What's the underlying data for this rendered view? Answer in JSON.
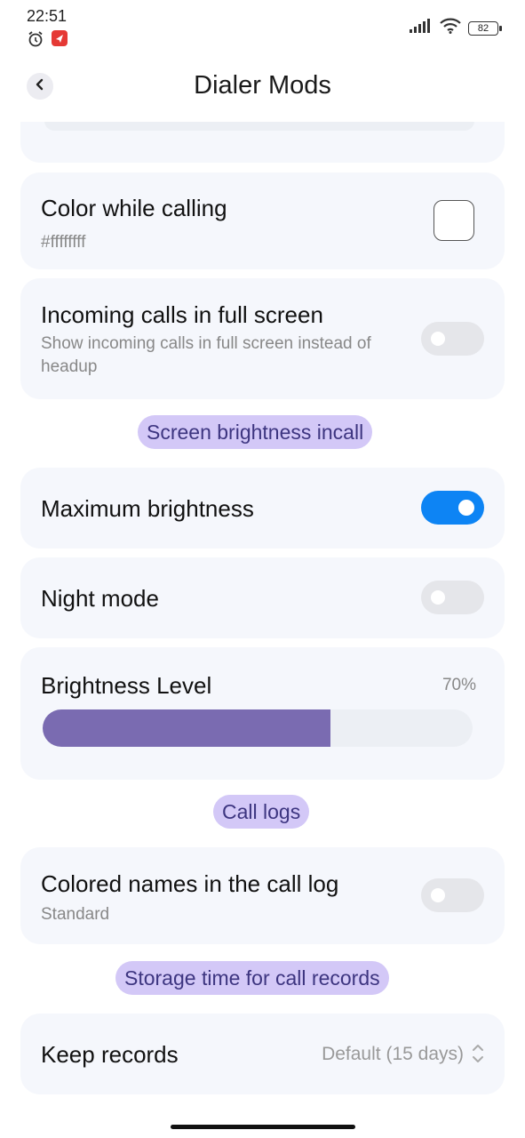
{
  "status_bar": {
    "time": "22:51",
    "battery": "82",
    "icons": [
      "alarm-icon",
      "app-notification-icon",
      "signal-icon",
      "wifi-icon",
      "battery-icon"
    ]
  },
  "header": {
    "title": "Dialer Mods",
    "back_icon": "chevron-left-icon"
  },
  "settings": {
    "color_while_calling": {
      "title": "Color while calling",
      "value": "#ffffffff"
    },
    "incoming_fullscreen": {
      "title": "Incoming calls in full screen",
      "subtitle_line1": "Show incoming calls in full screen instead of",
      "subtitle_line2": "headup",
      "enabled": false
    },
    "section_brightness": "Screen brightness incall",
    "max_brightness": {
      "title": "Maximum brightness",
      "enabled": true
    },
    "night_mode": {
      "title": "Night mode",
      "enabled": false
    },
    "brightness_level": {
      "title": "Brightness Level",
      "value_text": "70%",
      "fraction": 0.67
    },
    "section_call_logs": "Call logs",
    "colored_names": {
      "title": "Colored names in the call log",
      "subtitle": "Standard",
      "enabled": false
    },
    "section_storage": "Storage time for call records",
    "keep_records": {
      "title": "Keep records",
      "value": "Default (15 days)"
    }
  },
  "colors": {
    "accent_toggle": "#0d84f4",
    "chip_bg": "#d3c8f7",
    "chip_text": "#3d3580",
    "slider_fill": "#7a6bb1",
    "card_bg": "#f5f7fc"
  }
}
